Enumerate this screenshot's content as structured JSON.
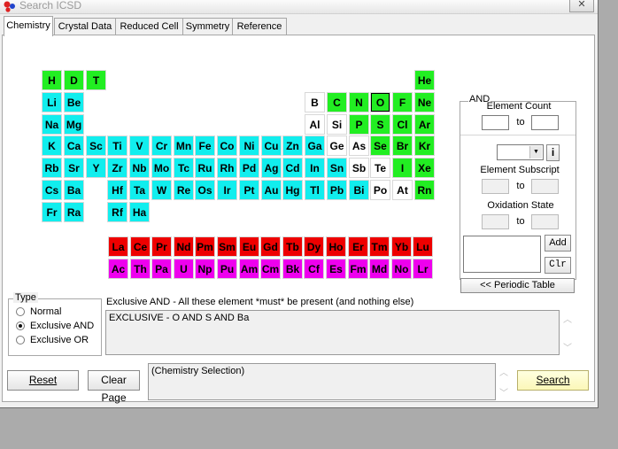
{
  "window": {
    "title": "Search ICSD",
    "close_glyph": "✕"
  },
  "tabs": [
    {
      "label": "Chemistry",
      "active": true
    },
    {
      "label": "Crystal Data",
      "active": false
    },
    {
      "label": "Reduced Cell",
      "active": false
    },
    {
      "label": "Symmetry",
      "active": false
    },
    {
      "label": "Reference",
      "active": false
    }
  ],
  "colors": {
    "green": "#22ee22",
    "cyan": "#11eeee",
    "white": "#ffffff",
    "red": "#ee0000",
    "magenta": "#ee00ee"
  },
  "elements": [
    {
      "s": "H",
      "r": 0,
      "c": 0,
      "k": "green"
    },
    {
      "s": "D",
      "r": 0,
      "c": 1,
      "k": "green"
    },
    {
      "s": "T",
      "r": 0,
      "c": 2,
      "k": "green"
    },
    {
      "s": "He",
      "r": 0,
      "c": 17,
      "k": "green"
    },
    {
      "s": "Li",
      "r": 1,
      "c": 0,
      "k": "cyan"
    },
    {
      "s": "Be",
      "r": 1,
      "c": 1,
      "k": "cyan"
    },
    {
      "s": "B",
      "r": 1,
      "c": 12,
      "k": "white"
    },
    {
      "s": "C",
      "r": 1,
      "c": 13,
      "k": "green"
    },
    {
      "s": "N",
      "r": 1,
      "c": 14,
      "k": "green"
    },
    {
      "s": "O",
      "r": 1,
      "c": 15,
      "k": "green",
      "sel": true
    },
    {
      "s": "F",
      "r": 1,
      "c": 16,
      "k": "green"
    },
    {
      "s": "Ne",
      "r": 1,
      "c": 17,
      "k": "green"
    },
    {
      "s": "Na",
      "r": 2,
      "c": 0,
      "k": "cyan"
    },
    {
      "s": "Mg",
      "r": 2,
      "c": 1,
      "k": "cyan"
    },
    {
      "s": "Al",
      "r": 2,
      "c": 12,
      "k": "white"
    },
    {
      "s": "Si",
      "r": 2,
      "c": 13,
      "k": "white"
    },
    {
      "s": "P",
      "r": 2,
      "c": 14,
      "k": "green"
    },
    {
      "s": "S",
      "r": 2,
      "c": 15,
      "k": "green"
    },
    {
      "s": "Cl",
      "r": 2,
      "c": 16,
      "k": "green"
    },
    {
      "s": "Ar",
      "r": 2,
      "c": 17,
      "k": "green"
    },
    {
      "s": "K",
      "r": 3,
      "c": 0,
      "k": "cyan"
    },
    {
      "s": "Ca",
      "r": 3,
      "c": 1,
      "k": "cyan"
    },
    {
      "s": "Sc",
      "r": 3,
      "c": 2,
      "k": "cyan"
    },
    {
      "s": "Ti",
      "r": 3,
      "c": 3,
      "k": "cyan"
    },
    {
      "s": "V",
      "r": 3,
      "c": 4,
      "k": "cyan"
    },
    {
      "s": "Cr",
      "r": 3,
      "c": 5,
      "k": "cyan"
    },
    {
      "s": "Mn",
      "r": 3,
      "c": 6,
      "k": "cyan"
    },
    {
      "s": "Fe",
      "r": 3,
      "c": 7,
      "k": "cyan"
    },
    {
      "s": "Co",
      "r": 3,
      "c": 8,
      "k": "cyan"
    },
    {
      "s": "Ni",
      "r": 3,
      "c": 9,
      "k": "cyan"
    },
    {
      "s": "Cu",
      "r": 3,
      "c": 10,
      "k": "cyan"
    },
    {
      "s": "Zn",
      "r": 3,
      "c": 11,
      "k": "cyan"
    },
    {
      "s": "Ga",
      "r": 3,
      "c": 12,
      "k": "cyan"
    },
    {
      "s": "Ge",
      "r": 3,
      "c": 13,
      "k": "white"
    },
    {
      "s": "As",
      "r": 3,
      "c": 14,
      "k": "white"
    },
    {
      "s": "Se",
      "r": 3,
      "c": 15,
      "k": "green"
    },
    {
      "s": "Br",
      "r": 3,
      "c": 16,
      "k": "green"
    },
    {
      "s": "Kr",
      "r": 3,
      "c": 17,
      "k": "green"
    },
    {
      "s": "Rb",
      "r": 4,
      "c": 0,
      "k": "cyan"
    },
    {
      "s": "Sr",
      "r": 4,
      "c": 1,
      "k": "cyan"
    },
    {
      "s": "Y",
      "r": 4,
      "c": 2,
      "k": "cyan"
    },
    {
      "s": "Zr",
      "r": 4,
      "c": 3,
      "k": "cyan"
    },
    {
      "s": "Nb",
      "r": 4,
      "c": 4,
      "k": "cyan"
    },
    {
      "s": "Mo",
      "r": 4,
      "c": 5,
      "k": "cyan"
    },
    {
      "s": "Tc",
      "r": 4,
      "c": 6,
      "k": "cyan"
    },
    {
      "s": "Ru",
      "r": 4,
      "c": 7,
      "k": "cyan"
    },
    {
      "s": "Rh",
      "r": 4,
      "c": 8,
      "k": "cyan"
    },
    {
      "s": "Pd",
      "r": 4,
      "c": 9,
      "k": "cyan"
    },
    {
      "s": "Ag",
      "r": 4,
      "c": 10,
      "k": "cyan"
    },
    {
      "s": "Cd",
      "r": 4,
      "c": 11,
      "k": "cyan"
    },
    {
      "s": "In",
      "r": 4,
      "c": 12,
      "k": "cyan"
    },
    {
      "s": "Sn",
      "r": 4,
      "c": 13,
      "k": "cyan"
    },
    {
      "s": "Sb",
      "r": 4,
      "c": 14,
      "k": "white"
    },
    {
      "s": "Te",
      "r": 4,
      "c": 15,
      "k": "white"
    },
    {
      "s": "I",
      "r": 4,
      "c": 16,
      "k": "green"
    },
    {
      "s": "Xe",
      "r": 4,
      "c": 17,
      "k": "green"
    },
    {
      "s": "Cs",
      "r": 5,
      "c": 0,
      "k": "cyan"
    },
    {
      "s": "Ba",
      "r": 5,
      "c": 1,
      "k": "cyan"
    },
    {
      "s": "Hf",
      "r": 5,
      "c": 3,
      "k": "cyan"
    },
    {
      "s": "Ta",
      "r": 5,
      "c": 4,
      "k": "cyan"
    },
    {
      "s": "W",
      "r": 5,
      "c": 5,
      "k": "cyan"
    },
    {
      "s": "Re",
      "r": 5,
      "c": 6,
      "k": "cyan"
    },
    {
      "s": "Os",
      "r": 5,
      "c": 7,
      "k": "cyan"
    },
    {
      "s": "Ir",
      "r": 5,
      "c": 8,
      "k": "cyan"
    },
    {
      "s": "Pt",
      "r": 5,
      "c": 9,
      "k": "cyan"
    },
    {
      "s": "Au",
      "r": 5,
      "c": 10,
      "k": "cyan"
    },
    {
      "s": "Hg",
      "r": 5,
      "c": 11,
      "k": "cyan"
    },
    {
      "s": "Tl",
      "r": 5,
      "c": 12,
      "k": "cyan"
    },
    {
      "s": "Pb",
      "r": 5,
      "c": 13,
      "k": "cyan"
    },
    {
      "s": "Bi",
      "r": 5,
      "c": 14,
      "k": "cyan"
    },
    {
      "s": "Po",
      "r": 5,
      "c": 15,
      "k": "white"
    },
    {
      "s": "At",
      "r": 5,
      "c": 16,
      "k": "white"
    },
    {
      "s": "Rn",
      "r": 5,
      "c": 17,
      "k": "green"
    },
    {
      "s": "Fr",
      "r": 6,
      "c": 0,
      "k": "cyan"
    },
    {
      "s": "Ra",
      "r": 6,
      "c": 1,
      "k": "cyan"
    },
    {
      "s": "Rf",
      "r": 6,
      "c": 3,
      "k": "cyan"
    },
    {
      "s": "Ha",
      "r": 6,
      "c": 4,
      "k": "cyan"
    }
  ],
  "lanthanides": [
    "La",
    "Ce",
    "Pr",
    "Nd",
    "Pm",
    "Sm",
    "Eu",
    "Gd",
    "Tb",
    "Dy",
    "Ho",
    "Er",
    "Tm",
    "Yb",
    "Lu"
  ],
  "actinides": [
    "Ac",
    "Th",
    "Pa",
    "U",
    "Np",
    "Pu",
    "Am",
    "Cm",
    "Bk",
    "Cf",
    "Es",
    "Fm",
    "Md",
    "No",
    "Lr"
  ],
  "and_panel": {
    "title": "AND",
    "element_count_label": "Element Count",
    "to1": "to",
    "info_button": "i",
    "element_subscript_label": "Element Subscript",
    "to2": "to",
    "oxidation_state_label": "Oxidation State",
    "to3": "to",
    "add_button": "Add",
    "clr_button": "Clr",
    "periodic_table_button": "<< Periodic Table"
  },
  "type_group": {
    "title": "Type",
    "options": [
      {
        "label": "Normal",
        "selected": false
      },
      {
        "label": "Exclusive AND",
        "selected": true
      },
      {
        "label": "Exclusive OR",
        "selected": false
      }
    ]
  },
  "description": "Exclusive AND - All these element *must* be present (and nothing else)",
  "query_text": "EXCLUSIVE - O AND S AND Ba",
  "selection_text": "(Chemistry Selection)",
  "buttons": {
    "reset": "Reset",
    "clear_page": "Clear Page",
    "search": "Search"
  }
}
